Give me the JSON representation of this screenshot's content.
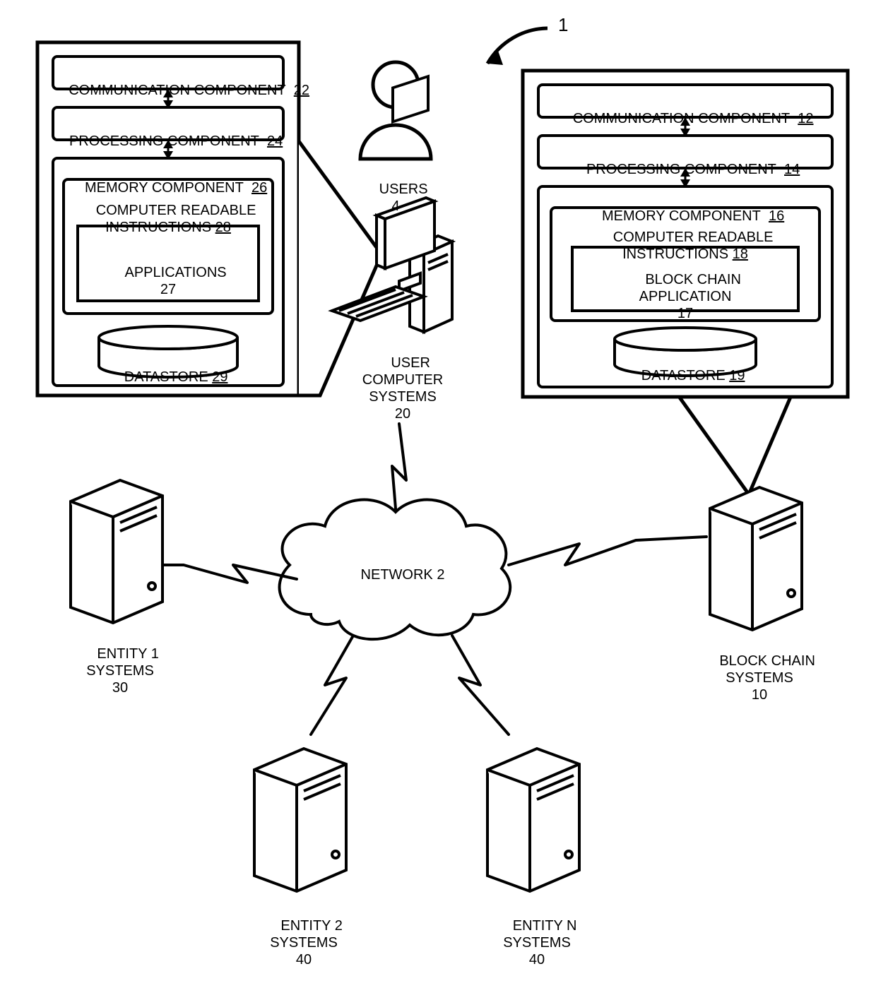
{
  "figure_ref": "1",
  "network": {
    "label": "NETWORK 2"
  },
  "users": {
    "label": "USERS",
    "ref": "4"
  },
  "user_computer": {
    "label": "USER\nCOMPUTER\nSYSTEMS",
    "ref": "20"
  },
  "blockchain_systems": {
    "label": "BLOCK CHAIN\nSYSTEMS",
    "ref": "10"
  },
  "entity1": {
    "label": "ENTITY 1\nSYSTEMS",
    "ref": "30"
  },
  "entity2": {
    "label": "ENTITY 2\nSYSTEMS",
    "ref": "40"
  },
  "entityN": {
    "label": "ENTITY N\nSYSTEMS",
    "ref": "40"
  },
  "left_panel": {
    "comm": {
      "label": "COMMUNICATION COMPONENT",
      "ref": "22"
    },
    "proc": {
      "label": "PROCESSING COMPONENT",
      "ref": "24"
    },
    "mem": {
      "label": "MEMORY COMPONENT",
      "ref": "26"
    },
    "instr": {
      "label": "COMPUTER READABLE\nINSTRUCTIONS",
      "ref": "28"
    },
    "app": {
      "label": "APPLICATIONS",
      "ref": "27"
    },
    "ds": {
      "label": "DATASTORE",
      "ref": "29"
    }
  },
  "right_panel": {
    "comm": {
      "label": "COMMUNICATION COMPONENT",
      "ref": "12"
    },
    "proc": {
      "label": "PROCESSING COMPONENT",
      "ref": "14"
    },
    "mem": {
      "label": "MEMORY COMPONENT",
      "ref": "16"
    },
    "instr": {
      "label": "COMPUTER READABLE\nINSTRUCTIONS",
      "ref": "18"
    },
    "app": {
      "label": "BLOCK CHAIN\nAPPLICATION",
      "ref": "17"
    },
    "ds": {
      "label": "DATASTORE",
      "ref": "19"
    }
  }
}
